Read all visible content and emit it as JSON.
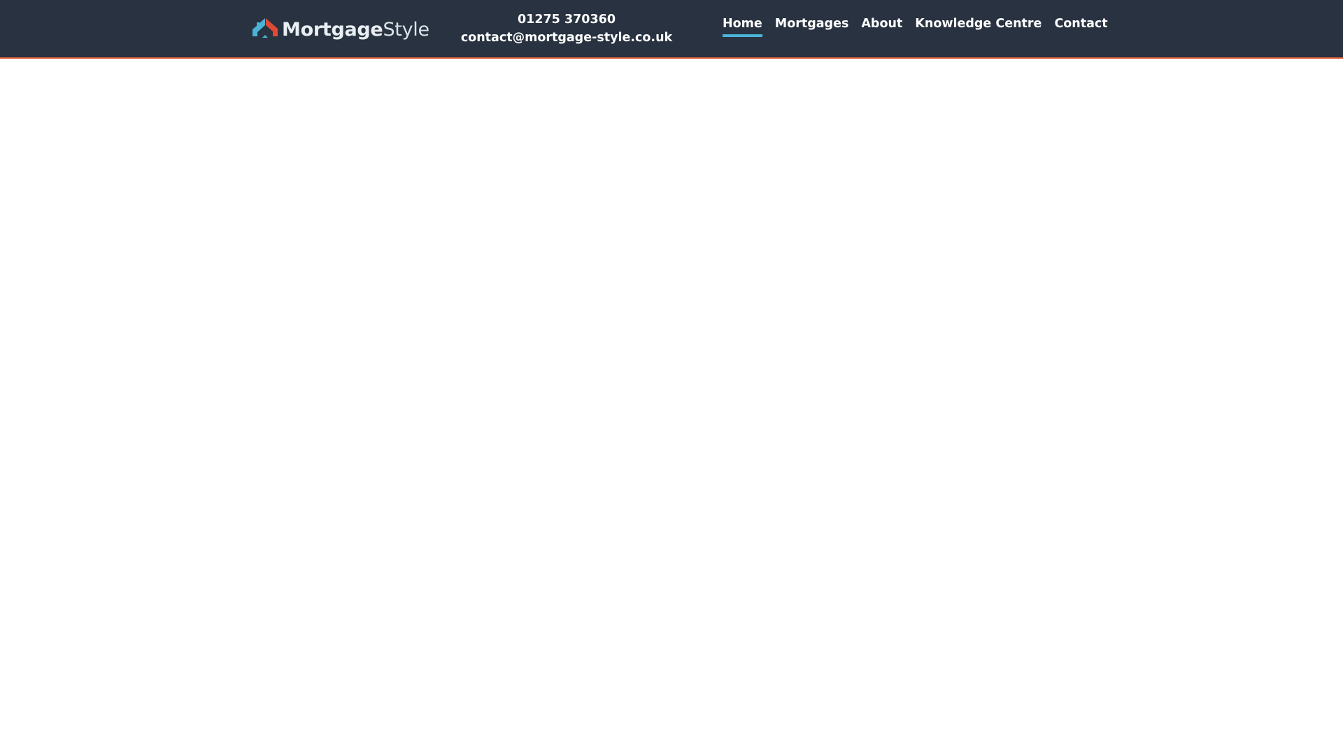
{
  "header": {
    "logo": {
      "text_bold": "Mortgage",
      "text_light": "Style",
      "icon": "house-roof-icon",
      "colors": {
        "left_roof": "#4ab3d8",
        "right_roof": "#e04a34",
        "door": "#4ab3d8"
      }
    },
    "contact": {
      "phone": "01275 370360",
      "email": "contact@mortgage-style.co.uk"
    },
    "nav": [
      {
        "label": "Home",
        "active": true
      },
      {
        "label": "Mortgages",
        "active": false
      },
      {
        "label": "About",
        "active": false
      },
      {
        "label": "Knowledge Centre",
        "active": false
      },
      {
        "label": "Contact",
        "active": false
      }
    ]
  },
  "colors": {
    "header_bg": "#283240",
    "header_border": "#e2623f",
    "accent": "#4ab3d8",
    "page_bg": "#ffffff"
  }
}
